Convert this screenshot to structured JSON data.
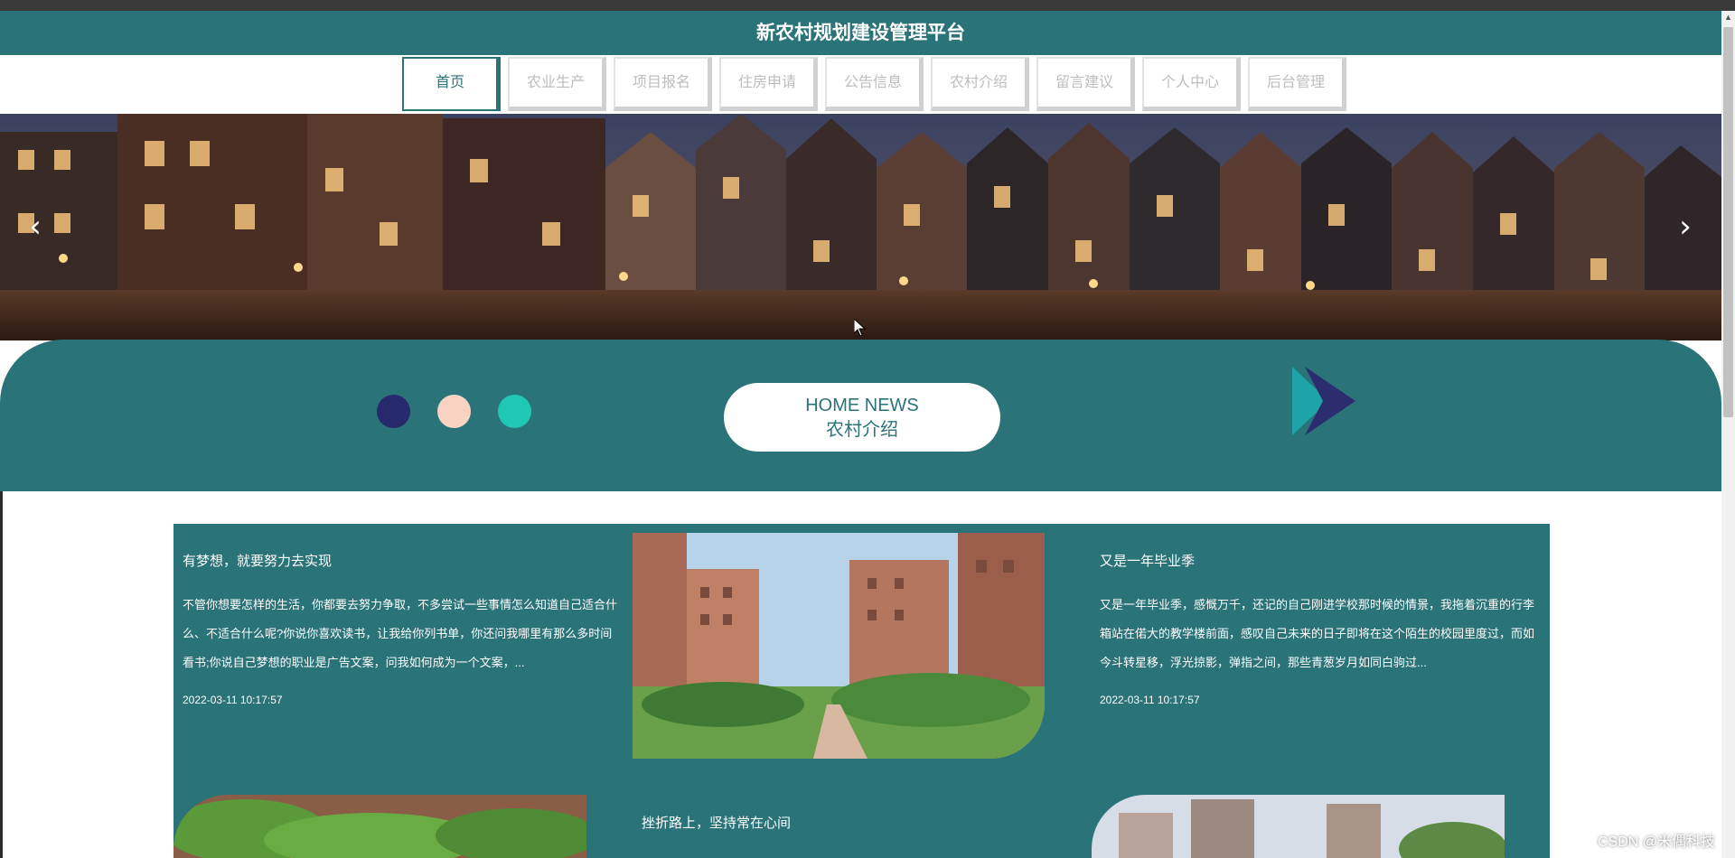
{
  "header": {
    "title": "新农村规划建设管理平台"
  },
  "nav": {
    "items": [
      {
        "label": "首页"
      },
      {
        "label": "农业生产"
      },
      {
        "label": "项目报名"
      },
      {
        "label": "住房申请"
      },
      {
        "label": "公告信息"
      },
      {
        "label": "农村介绍"
      },
      {
        "label": "留言建议"
      },
      {
        "label": "个人中心"
      },
      {
        "label": "后台管理"
      }
    ]
  },
  "carousel": {
    "prev_icon": "chevron-left-icon",
    "next_icon": "chevron-right-icon"
  },
  "news_section": {
    "heading_en": "HOME NEWS",
    "heading_cn": "农村介绍",
    "dot_colors": [
      "#27296d",
      "#f8d3c2",
      "#1ec8b4"
    ],
    "arrow_icon": "play-arrow-icon"
  },
  "news": [
    {
      "title": "有梦想，就要努力去实现",
      "summary": "不管你想要怎样的生活，你都要去努力争取，不多尝试一些事情怎么知道自己适合什么、不适合什么呢?你说你喜欢读书，让我给你列书单，你还问我哪里有那么多时间看书;你说自己梦想的职业是广告文案，问我如何成为一个文案，...",
      "date": "2022-03-11 10:17:57"
    },
    {
      "title": "又是一年毕业季",
      "summary": "又是一年毕业季，感慨万千，还记的自己刚进学校那时候的情景，我拖着沉重的行李箱站在偌大的教学楼前面，感叹自己未来的日子即将在这个陌生的校园里度过，而如今斗转星移，浮光掠影，弹指之间，那些青葱岁月如同白驹过...",
      "date": "2022-03-11 10:17:57"
    },
    {
      "title": "挫折路上，坚持常在心间"
    }
  ],
  "watermark": "CSDN @米偶科技",
  "colors": {
    "primary": "#297379",
    "nav_inactive": "#bdbdbd"
  }
}
